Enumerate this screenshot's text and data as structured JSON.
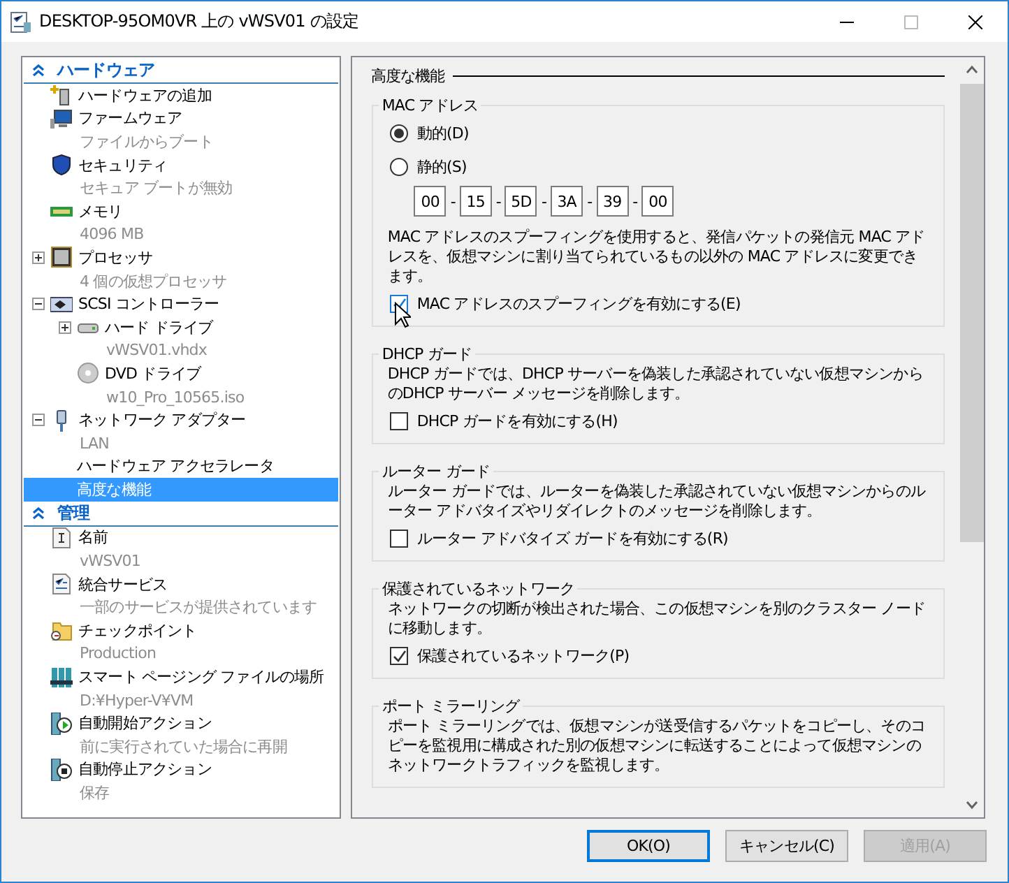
{
  "window": {
    "title": "DESKTOP-95OM0VR 上の vWSV01 の設定"
  },
  "sidebar": {
    "sections": [
      {
        "title": "ハードウェア",
        "expanded": true,
        "items": [
          {
            "label": "ハードウェアの追加",
            "selected": false
          },
          {
            "label": "ファームウェア",
            "detail": "ファイルからブート",
            "selected": false
          },
          {
            "label": "セキュリティ",
            "detail": "セキュア ブートが無効",
            "selected": false
          },
          {
            "label": "メモリ",
            "detail": "4096 MB",
            "selected": false
          },
          {
            "label": "プロセッサ",
            "detail": "4 個の仮想プロセッサ",
            "selected": false,
            "expanded": false
          },
          {
            "label": "SCSI コントローラー",
            "selected": false,
            "expanded": true,
            "children": [
              {
                "label": "ハード ドライブ",
                "detail": "vWSV01.vhdx",
                "selected": false,
                "expanded": false
              },
              {
                "label": "DVD ドライブ",
                "detail": "w10_Pro_10565.iso",
                "selected": false
              }
            ]
          },
          {
            "label": "ネットワーク アダプター",
            "detail": "LAN",
            "selected": false,
            "expanded": true,
            "children": [
              {
                "label": "ハードウェア アクセラレータ",
                "selected": false
              },
              {
                "label": "高度な機能",
                "selected": true
              }
            ]
          }
        ]
      },
      {
        "title": "管理",
        "expanded": true,
        "items": [
          {
            "label": "名前",
            "detail": "vWSV01",
            "selected": false
          },
          {
            "label": "統合サービス",
            "detail": "一部のサービスが提供されています",
            "selected": false
          },
          {
            "label": "チェックポイント",
            "detail": "Production",
            "selected": false
          },
          {
            "label": "スマート ページング ファイルの場所",
            "detail": "D:¥Hyper-V¥VM",
            "selected": false
          },
          {
            "label": "自動開始アクション",
            "detail": "前に実行されていた場合に再開",
            "selected": false
          },
          {
            "label": "自動停止アクション",
            "detail": "保存",
            "selected": false
          }
        ]
      }
    ]
  },
  "panel": {
    "heading": "高度な機能",
    "groups": [
      {
        "kind": "mac",
        "title": "MAC アドレス",
        "radios": [
          {
            "label": "動的(D)",
            "selected": true
          },
          {
            "label": "静的(S)",
            "selected": false
          }
        ],
        "mac_address": {
          "separator": "-",
          "octets": [
            "00",
            "15",
            "5D",
            "3A",
            "39",
            "00"
          ]
        },
        "description": "MAC アドレスのスプーフィングを使用すると、発信パケットの発信元 MAC アドレスを、仮想マシンに割り当てられているもの以外の MAC アドレスに変更できます。",
        "checkbox": {
          "label": "MAC アドレスのスプーフィングを有効にする(E)",
          "checked": true,
          "hover": true
        }
      },
      {
        "kind": "option",
        "title": "DHCP ガード",
        "description": "DHCP ガードでは、DHCP サーバーを偽装した承認されていない仮想マシンからのDHCP サーバー メッセージを削除します。",
        "checkbox": {
          "label": "DHCP ガードを有効にする(H)",
          "checked": false,
          "hover": false
        }
      },
      {
        "kind": "option",
        "title": "ルーター ガード",
        "description": "ルーター ガードでは、ルーターを偽装した承認されていない仮想マシンからのルーター アドバタイズやリダイレクトのメッセージを削除します。",
        "checkbox": {
          "label": "ルーター アドバタイズ ガードを有効にする(R)",
          "checked": false,
          "hover": false
        }
      },
      {
        "kind": "option",
        "title": "保護されているネットワーク",
        "description": "ネットワークの切断が検出された場合、この仮想マシンを別のクラスター ノードに移動します。",
        "checkbox": {
          "label": "保護されているネットワーク(P)",
          "checked": true,
          "hover": false
        }
      },
      {
        "kind": "option",
        "title": "ポート ミラーリング",
        "description": "ポート ミラーリングでは、仮想マシンが送受信するパケットをコピーし、そのコピーを監視用に構成された別の仮想マシンに転送することによって仮想マシンのネットワークトラフィックを監視します。"
      }
    ]
  },
  "buttons": [
    {
      "label": "OK(O)",
      "default": true,
      "disabled": false
    },
    {
      "label": "キャンセル(C)",
      "default": false,
      "disabled": false
    },
    {
      "label": "適用(A)",
      "default": false,
      "disabled": true
    }
  ]
}
